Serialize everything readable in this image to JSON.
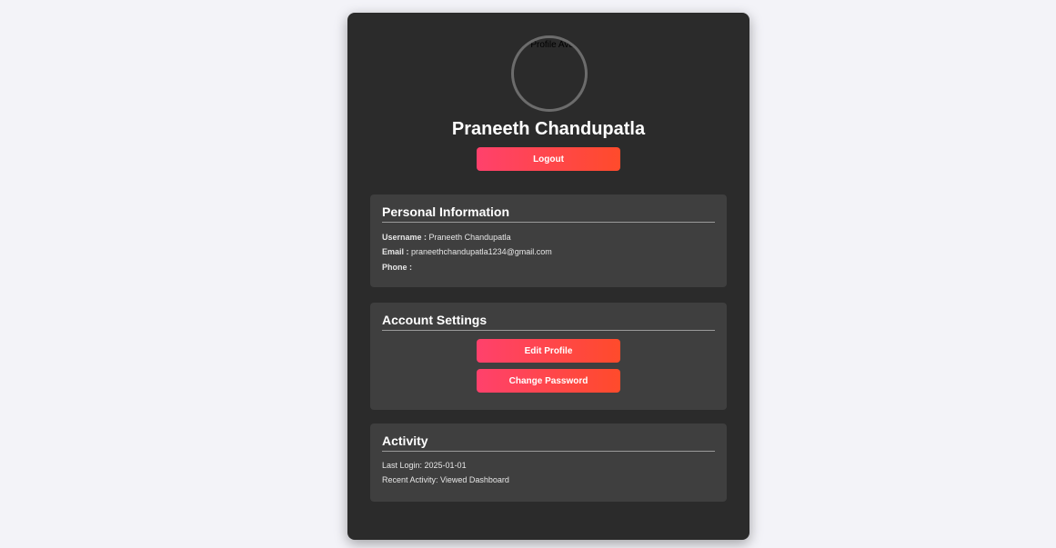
{
  "profile": {
    "avatar_alt": "Profile Avatar",
    "name": "Praneeth Chandupatla",
    "logout_label": "Logout"
  },
  "personal": {
    "title": "Personal Information",
    "username_label": "Username :",
    "username_value": "Praneeth Chandupatla",
    "email_label": "Email :",
    "email_value": "praneethchandupatla1234@gmail.com",
    "phone_label": "Phone :",
    "phone_value": ""
  },
  "settings": {
    "title": "Account Settings",
    "edit_profile_label": "Edit Profile",
    "change_password_label": "Change Password"
  },
  "activity": {
    "title": "Activity",
    "last_login": "Last Login: 2025-01-01",
    "recent_activity": "Recent Activity: Viewed Dashboard"
  },
  "colors": {
    "page_bg": "#f3f3f8",
    "card_bg": "#2b2b2b",
    "section_bg": "#3f3f3f",
    "button_gradient_start": "#ff416c",
    "button_gradient_end": "#ff4b2b"
  }
}
